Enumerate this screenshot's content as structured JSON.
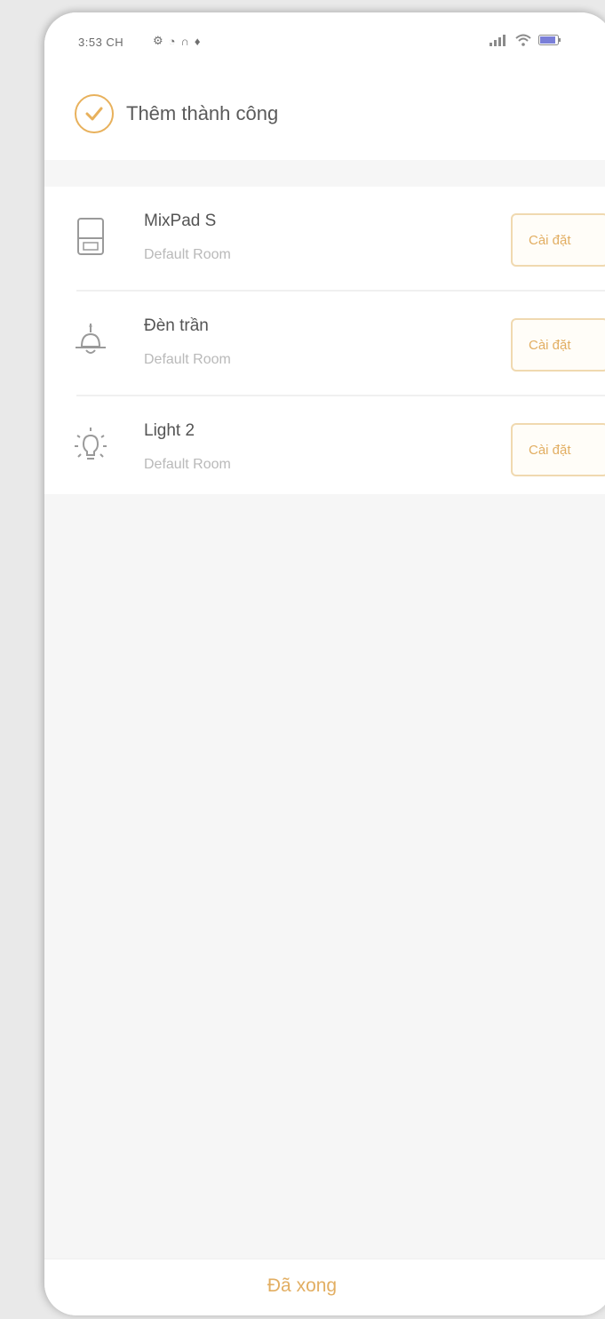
{
  "status_bar": {
    "time": "3:53 CH",
    "left_icons": [
      "settings-icon",
      "notification-icon",
      "headset-icon",
      "drop-icon"
    ],
    "right_icons": [
      "signal-icon",
      "wifi-icon",
      "battery-icon"
    ]
  },
  "header": {
    "success_text": "Thêm thành công"
  },
  "devices": [
    {
      "name": "MixPad S",
      "room": "Default Room",
      "action": "Cài đặt",
      "icon": "panel-icon"
    },
    {
      "name": "Đèn trần",
      "room": "Default Room",
      "action": "Cài đặt",
      "icon": "ceiling-lamp-icon"
    },
    {
      "name": "Light 2",
      "room": "Default Room",
      "action": "Cài đặt",
      "icon": "light-bulb-icon"
    }
  ],
  "footer": {
    "done_label": "Đã xong"
  },
  "colors": {
    "accent": "#e2ae62",
    "accent_border": "#f0d9b0",
    "background": "#f6f6f6"
  }
}
